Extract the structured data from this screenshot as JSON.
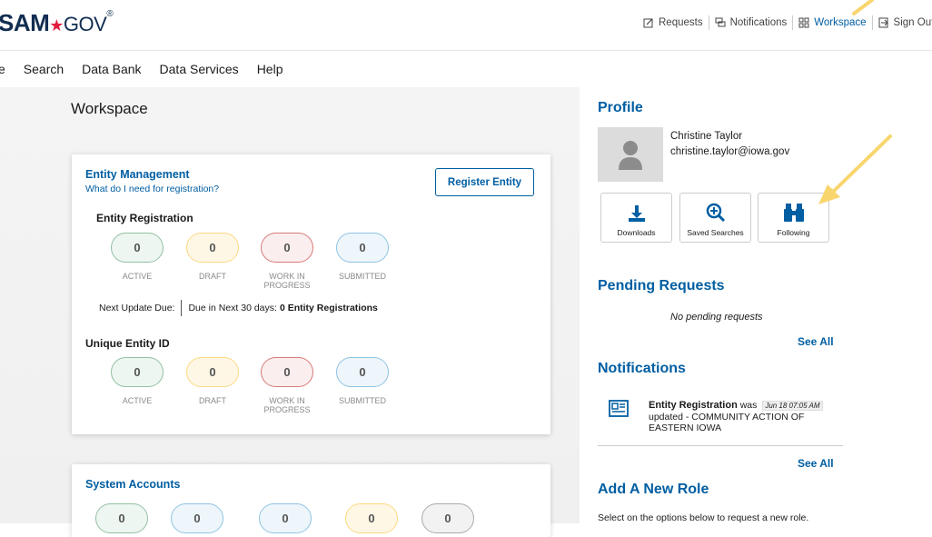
{
  "header": {
    "logo_main": "SAM",
    "logo_star": "★",
    "logo_gov": "GOV",
    "logo_reg": "®",
    "links": [
      {
        "label": "Requests"
      },
      {
        "label": "Notifications"
      },
      {
        "label": "Workspace"
      },
      {
        "label": "Sign Out"
      }
    ]
  },
  "nav": {
    "partial": "e",
    "items": [
      "Search",
      "Data Bank",
      "Data Services",
      "Help"
    ]
  },
  "workspace": {
    "title": "Workspace",
    "entity_management": {
      "title": "Entity Management",
      "link": "What do I need for registration?",
      "register_button": "Register Entity",
      "entity_registration": {
        "title": "Entity Registration",
        "counts": [
          {
            "value": "0",
            "label": "ACTIVE"
          },
          {
            "value": "0",
            "label": "DRAFT"
          },
          {
            "value": "0",
            "label": "WORK IN PROGRESS"
          },
          {
            "value": "0",
            "label": "SUBMITTED"
          }
        ],
        "next_update_label": "Next Update Due:",
        "next_update_prefix": "Due in Next 30 days: ",
        "next_update_value": "0 Entity Registrations"
      },
      "unique_entity_id": {
        "title": "Unique Entity ID",
        "counts": [
          {
            "value": "0",
            "label": "ACTIVE"
          },
          {
            "value": "0",
            "label": "DRAFT"
          },
          {
            "value": "0",
            "label": "WORK IN PROGRESS"
          },
          {
            "value": "0",
            "label": "SUBMITTED"
          }
        ]
      }
    },
    "system_accounts": {
      "title": "System Accounts",
      "counts": [
        "0",
        "0",
        "0",
        "0",
        "0"
      ]
    }
  },
  "profile": {
    "title": "Profile",
    "name": "Christine Taylor",
    "email": "christine.taylor@iowa.gov",
    "quick_links": [
      {
        "label": "Downloads",
        "icon": "download-icon"
      },
      {
        "label": "Saved Searches",
        "icon": "search-plus-icon"
      },
      {
        "label": "Following",
        "icon": "binoculars-icon"
      }
    ]
  },
  "pending_requests": {
    "title": "Pending Requests",
    "empty_text": "No pending requests",
    "see_all": "See All"
  },
  "notifications": {
    "title": "Notifications",
    "item": {
      "subject": "Entity Registration",
      "was": " was ",
      "date": "Jun 18 07:05 AM",
      "rest": "updated - COMMUNITY ACTION OF EASTERN IOWA"
    },
    "see_all": "See All"
  },
  "add_role": {
    "title": "Add A New Role",
    "text": "Select on the options below to request a new role."
  },
  "colors": {
    "primary": "#005ea2",
    "nav_active": "#2e8540",
    "arrow": "#f9d56e"
  }
}
